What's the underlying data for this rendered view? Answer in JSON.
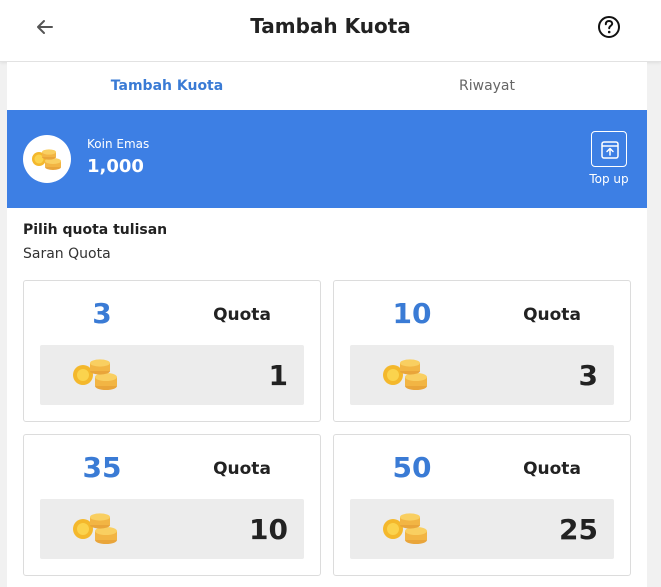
{
  "header": {
    "title": "Tambah Kuota",
    "back_icon": "arrow-left-icon",
    "help_icon": "question-circle-icon"
  },
  "tabs": [
    {
      "label": "Tambah Kuota",
      "active": true
    },
    {
      "label": "Riwayat",
      "active": false
    }
  ],
  "wallet": {
    "label": "Koin Emas",
    "balance": "1,000",
    "topup_label": "Top up",
    "topup_icon": "wallet-upload-icon",
    "coin_icon": "gold-coins-icon",
    "accent_color": "#3d7fe4"
  },
  "section": {
    "title": "Pilih quota tulisan",
    "subtitle": "Saran Quota"
  },
  "packages": [
    {
      "quota": "3",
      "unit": "Quota",
      "price": "1"
    },
    {
      "quota": "10",
      "unit": "Quota",
      "price": "3"
    },
    {
      "quota": "35",
      "unit": "Quota",
      "price": "10"
    },
    {
      "quota": "50",
      "unit": "Quota",
      "price": "25"
    }
  ]
}
